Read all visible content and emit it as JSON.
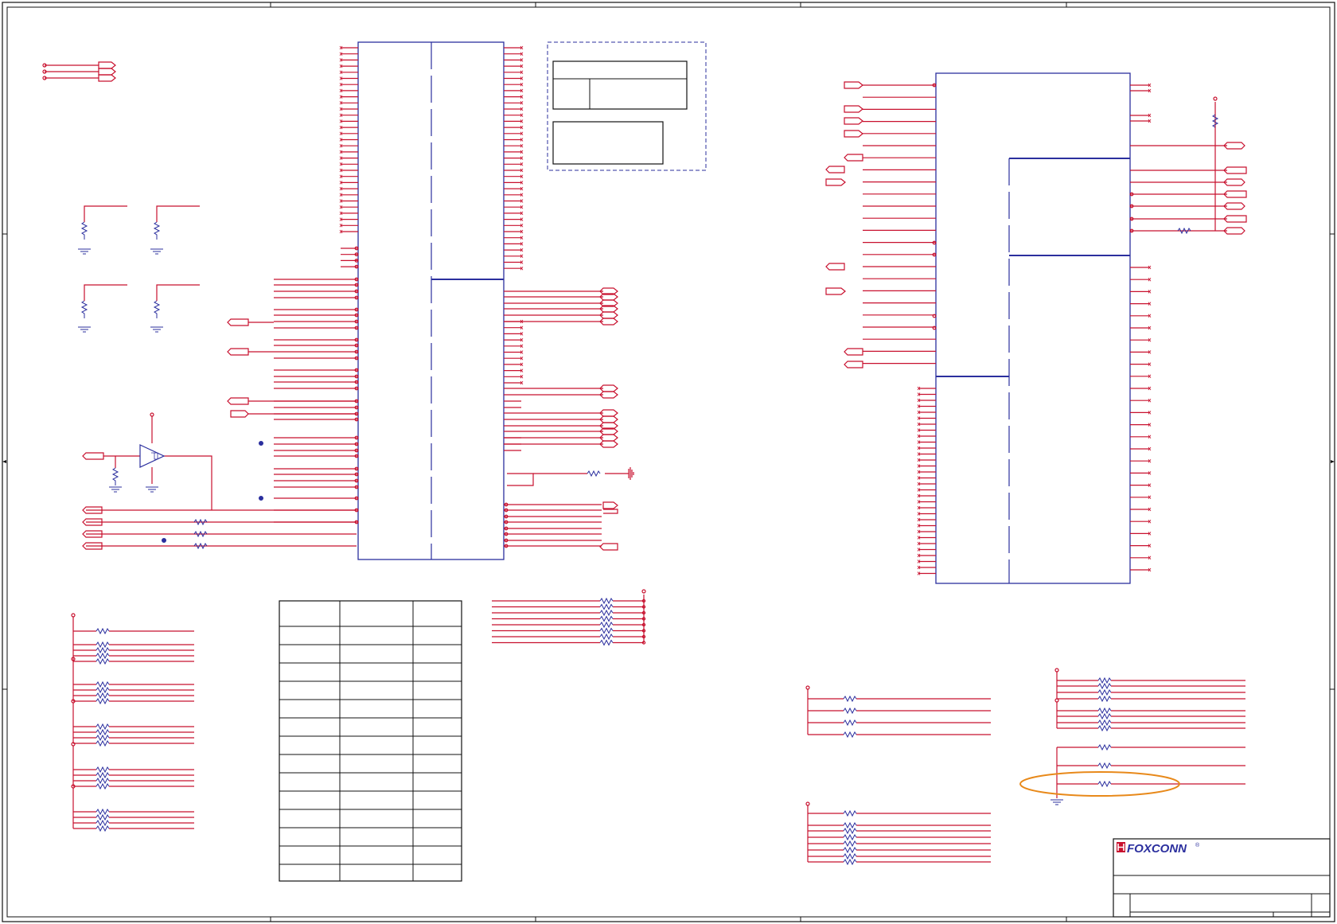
{
  "title_block": {
    "company": "FOXCONN",
    "registered_mark": "®"
  },
  "colors": {
    "wire": "#c8102e",
    "component": "#2b2f9e",
    "highlight": "#e8891a",
    "border": "#111111"
  },
  "icons": {
    "logo": "foxconn-logo-icon",
    "resistor": "resistor-icon",
    "ground": "ground-icon",
    "buffer": "buffer-gate-icon",
    "port": "port-flag-icon",
    "diff_port": "diff-port-icon"
  }
}
